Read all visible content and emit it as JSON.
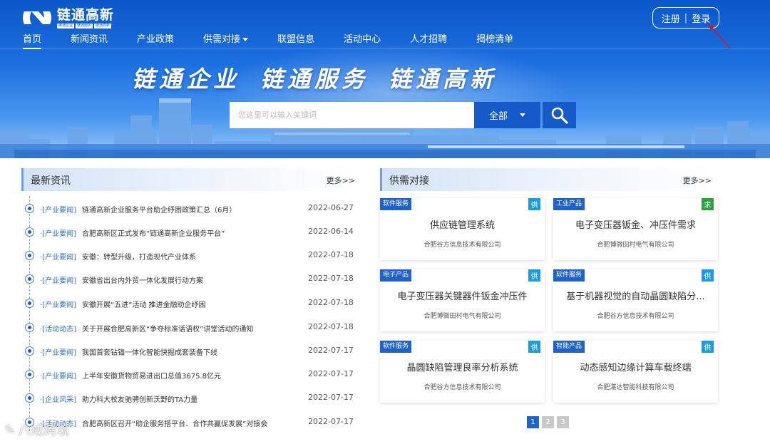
{
  "header": {
    "logo_text": "链通高新",
    "logo_tags": [
      "链通企业",
      "链通服务",
      "链通高新"
    ],
    "auth": {
      "register": "注册",
      "separator": "|",
      "login": "登录"
    },
    "nav": [
      {
        "label": "首页",
        "active": true
      },
      {
        "label": "新闻资讯"
      },
      {
        "label": "产业政策"
      },
      {
        "label": "供需对接",
        "dropdown": true
      },
      {
        "label": "联盟信息"
      },
      {
        "label": "活动中心"
      },
      {
        "label": "人才招聘"
      },
      {
        "label": "揭榜清单"
      }
    ],
    "slogan": [
      "链通企业",
      "链通服务",
      "链通高新"
    ]
  },
  "search": {
    "placeholder": "您这里可以输入关键词",
    "scope": "全部"
  },
  "news": {
    "title": "最新资讯",
    "more": "更多>>",
    "items": [
      {
        "category": "·[产业要闻]",
        "title": "链通高新企业服务平台助企纾困政策汇总（6月）",
        "date": "2022-06-27"
      },
      {
        "category": "·[产业要闻]",
        "title": "合肥高新区正式发布“链通高新企业服务平台”",
        "date": "2022-06-14"
      },
      {
        "category": "·[产业要闻]",
        "title": "安徽：转型升级，打造现代产业体系",
        "date": "2022-07-18"
      },
      {
        "category": "·[产业要闻]",
        "title": "安徽省出台内外贸一体化发展行动方案",
        "date": "2022-07-18"
      },
      {
        "category": "·[产业要闻]",
        "title": "安徽开展“五进”活动 推进金融助企纾困",
        "date": "2022-07-18"
      },
      {
        "category": "·[活动动态]",
        "title": "关于开展合肥高新区“争夺标准话语权”讲堂活动的通知",
        "date": "2022-07-18"
      },
      {
        "category": "·[产业要闻]",
        "title": "我国首套钻锚一体化智能快掘成套装备下线",
        "date": "2022-07-17"
      },
      {
        "category": "·[产业要闻]",
        "title": "上半年安徽货物贸易进出口总值3675.8亿元",
        "date": "2022-07-17"
      },
      {
        "category": "·[企业风采]",
        "title": "助力科大校友驰骋创新沃野的TA力量",
        "date": "2022-07-17"
      },
      {
        "category": "·[活动动态]",
        "title": "合肥高新区召开“助企服务搭平台、合作共赢促发展”对接会",
        "date": "2022-07-17"
      }
    ]
  },
  "supply": {
    "title": "供需对接",
    "more": "更多>>",
    "cards": [
      {
        "tag": "软件服务",
        "type": "供",
        "kind": "supply",
        "title": "供应链管理系统",
        "company": "合肥谷方信息技术有限公司"
      },
      {
        "tag": "工业产品",
        "type": "求",
        "kind": "demand",
        "title": "电子变压器钣金、冲压件需求",
        "company": "合肥博微田村电气有限公司"
      },
      {
        "tag": "电子产品",
        "type": "供",
        "kind": "supply",
        "title": "电子变压器关键器件钣金冲压件",
        "company": "合肥博微田村电气有限公司"
      },
      {
        "tag": "软件服务",
        "type": "供",
        "kind": "supply",
        "title": "基于机器视觉的自动晶圆缺陷分...",
        "company": "合肥谷方信息技术有限公司"
      },
      {
        "tag": "软件服务",
        "type": "供",
        "kind": "supply",
        "title": "晶圆缺陷管理良率分析系统",
        "company": "合肥谷方信息技术有限公司"
      },
      {
        "tag": "智能产品",
        "type": "供",
        "kind": "supply",
        "title": "动态感知边缘计算车载终端",
        "company": "合肥湛达智能科技有限公司"
      }
    ],
    "pages": [
      "1",
      "2",
      "3"
    ],
    "active_page": 1
  },
  "watermark": "八戒跨境",
  "colors": {
    "primary": "#1659c8",
    "link": "#2f6fd0",
    "supply_badge": "#1e9be0",
    "demand_badge": "#2aa33c"
  }
}
